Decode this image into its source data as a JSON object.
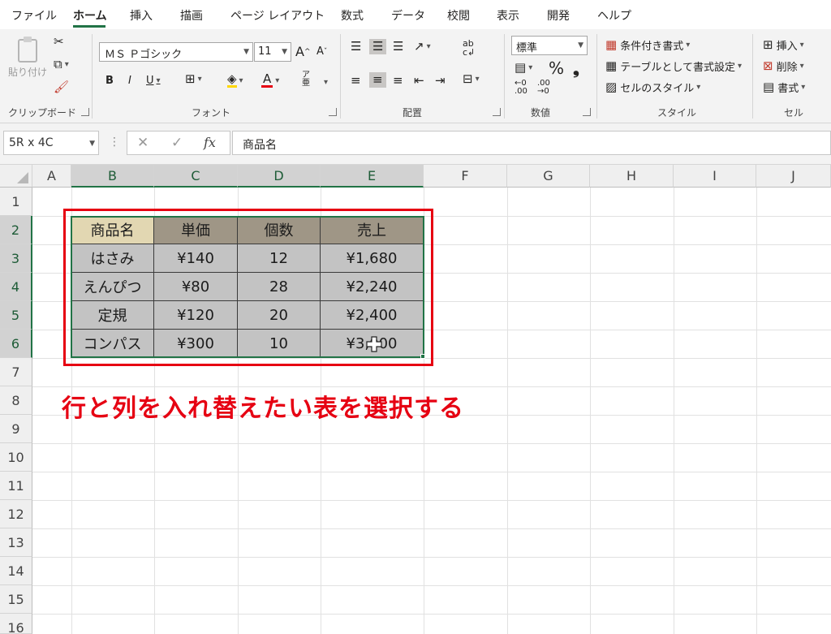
{
  "ribbon_tabs": [
    {
      "label": "ファイル"
    },
    {
      "label": "ホーム"
    },
    {
      "label": "挿入"
    },
    {
      "label": "描画"
    },
    {
      "label": "ページ レイアウト"
    },
    {
      "label": "数式"
    },
    {
      "label": "データ"
    },
    {
      "label": "校閲"
    },
    {
      "label": "表示"
    },
    {
      "label": "開発"
    },
    {
      "label": "ヘルプ"
    }
  ],
  "clipboard": {
    "paste_label": "貼り付け",
    "group_label": "クリップボード"
  },
  "font": {
    "family": "ＭＳ Ｐゴシック",
    "size": "11",
    "grow_label": "A",
    "shrink_label": "A",
    "bold": "B",
    "italic": "I",
    "underline": "U",
    "font_color": "A",
    "group_label": "フォント"
  },
  "alignment": {
    "group_label": "配置"
  },
  "number": {
    "format": "標準",
    "percent": "%",
    "comma": "❟",
    "group_label": "数値"
  },
  "styles": {
    "conditional": "条件付き書式",
    "table": "テーブルとして書式設定",
    "cell_style": "セルのスタイル",
    "group_label": "スタイル"
  },
  "cells": {
    "insert": "挿入",
    "delete": "削除",
    "format": "書式",
    "group_label": "セル"
  },
  "formula_bar": {
    "name_box": "5R x 4C",
    "fx": "fx",
    "content": "商品名"
  },
  "columns": [
    "A",
    "B",
    "C",
    "D",
    "E",
    "F",
    "G",
    "H",
    "I",
    "J"
  ],
  "rows": [
    "1",
    "2",
    "3",
    "4",
    "5",
    "6",
    "7",
    "8",
    "9",
    "10",
    "11",
    "12",
    "13",
    "14",
    "15",
    "16"
  ],
  "table": {
    "headers": [
      "商品名",
      "単価",
      "個数",
      "売上"
    ],
    "rows": [
      [
        "はさみ",
        "¥140",
        "12",
        "¥1,680"
      ],
      [
        "えんぴつ",
        "¥80",
        "28",
        "¥2,240"
      ],
      [
        "定規",
        "¥120",
        "20",
        "¥2,400"
      ],
      [
        "コンパス",
        "¥300",
        "10",
        "¥3,000"
      ]
    ]
  },
  "annotation": "行と列を入れ替えたい表を選択する",
  "colors": {
    "accent": "#217346",
    "annotation": "#e60012",
    "header_fill": "#9f9686",
    "first_header_fill": "#e2d7b2",
    "body_fill": "#c3c3c3"
  }
}
